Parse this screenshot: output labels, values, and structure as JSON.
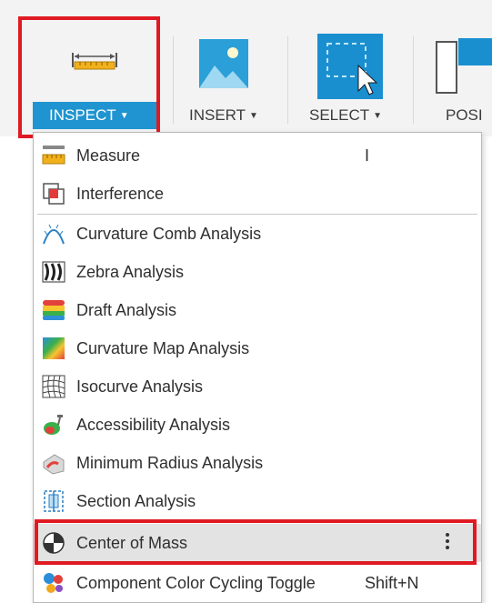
{
  "toolbar": {
    "groups": [
      {
        "label": "INSPECT",
        "icon": "ruler-measure-icon",
        "active": true
      },
      {
        "label": "INSERT",
        "icon": "insert-image-icon",
        "active": false
      },
      {
        "label": "SELECT",
        "icon": "select-cursor-icon",
        "active": false
      },
      {
        "label": "POSI",
        "icon": "position-icon",
        "active": false
      }
    ]
  },
  "menu": {
    "items": [
      {
        "label": "Measure",
        "shortcut": "I",
        "icon": "measure-icon"
      },
      {
        "label": "Interference",
        "shortcut": "",
        "icon": "interference-icon"
      },
      {
        "label": "Curvature Comb Analysis",
        "shortcut": "",
        "icon": "curvature-comb-icon"
      },
      {
        "label": "Zebra Analysis",
        "shortcut": "",
        "icon": "zebra-icon"
      },
      {
        "label": "Draft Analysis",
        "shortcut": "",
        "icon": "draft-analysis-icon"
      },
      {
        "label": "Curvature Map Analysis",
        "shortcut": "",
        "icon": "curvature-map-icon"
      },
      {
        "label": "Isocurve Analysis",
        "shortcut": "",
        "icon": "isocurve-icon"
      },
      {
        "label": "Accessibility Analysis",
        "shortcut": "",
        "icon": "accessibility-icon"
      },
      {
        "label": "Minimum Radius Analysis",
        "shortcut": "",
        "icon": "minimum-radius-icon"
      },
      {
        "label": "Section Analysis",
        "shortcut": "",
        "icon": "section-analysis-icon"
      },
      {
        "label": "Center of Mass",
        "shortcut": "",
        "icon": "center-of-mass-icon",
        "highlighted": true
      },
      {
        "label": "Component Color Cycling Toggle",
        "shortcut": "Shift+N",
        "icon": "color-cycling-icon"
      }
    ]
  },
  "colors": {
    "accent_blue": "#1f94d0",
    "highlight_red": "#e01a22",
    "hover_gray": "#e3e3e3"
  }
}
